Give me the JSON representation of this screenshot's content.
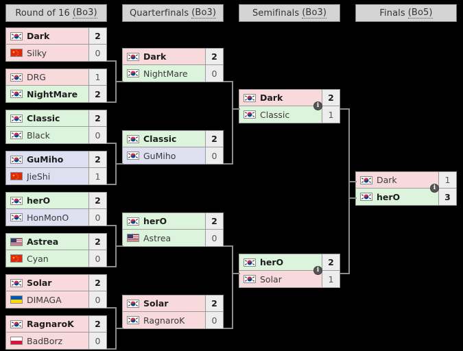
{
  "tournament": {
    "rounds": [
      {
        "id": "ro16",
        "label": "Round of 16",
        "format": "(Bo3)"
      },
      {
        "id": "qf",
        "label": "Quarterfinals",
        "format": "(Bo3)"
      },
      {
        "id": "sf",
        "label": "Semifinals",
        "format": "(Bo3)"
      },
      {
        "id": "f",
        "label": "Finals",
        "format": "(Bo5)"
      }
    ]
  },
  "colors": {
    "zerg": "#f8dadd",
    "protoss": "#dcf3dc",
    "terran": "#dfdff2",
    "score_cell": "#ededed",
    "header_bg": "#d4d4d4",
    "border": "#9a9a9a",
    "connector": "#8d8d8d",
    "background": "#000000",
    "info_badge": "#555555"
  },
  "info_badge": {
    "glyph": "i",
    "name": "match-info-icon"
  },
  "matches": {
    "ro16": [
      {
        "id": "ro16-m1",
        "top": {
          "name": "Dark",
          "score": "2",
          "flag": "kr",
          "race": "zerg",
          "winner": true
        },
        "bottom": {
          "name": "Silky",
          "score": "0",
          "flag": "cn",
          "race": "zerg",
          "winner": false
        }
      },
      {
        "id": "ro16-m2",
        "top": {
          "name": "DRG",
          "score": "1",
          "flag": "kr",
          "race": "zerg",
          "winner": false
        },
        "bottom": {
          "name": "NightMare",
          "score": "2",
          "flag": "kr",
          "race": "protoss",
          "winner": true
        }
      },
      {
        "id": "ro16-m3",
        "top": {
          "name": "Classic",
          "score": "2",
          "flag": "kr",
          "race": "protoss",
          "winner": true
        },
        "bottom": {
          "name": "Black",
          "score": "0",
          "flag": "kr",
          "race": "protoss",
          "winner": false
        }
      },
      {
        "id": "ro16-m4",
        "top": {
          "name": "GuMiho",
          "score": "2",
          "flag": "kr",
          "race": "terran",
          "winner": true
        },
        "bottom": {
          "name": "JieShi",
          "score": "1",
          "flag": "cn",
          "race": "terran",
          "winner": false
        }
      },
      {
        "id": "ro16-m5",
        "top": {
          "name": "herO",
          "score": "2",
          "flag": "kr",
          "race": "protoss",
          "winner": true
        },
        "bottom": {
          "name": "HonMonO",
          "score": "0",
          "flag": "kr",
          "race": "terran",
          "winner": false
        }
      },
      {
        "id": "ro16-m6",
        "top": {
          "name": "Astrea",
          "score": "2",
          "flag": "us",
          "race": "protoss",
          "winner": true
        },
        "bottom": {
          "name": "Cyan",
          "score": "0",
          "flag": "cn",
          "race": "protoss",
          "winner": false
        }
      },
      {
        "id": "ro16-m7",
        "top": {
          "name": "Solar",
          "score": "2",
          "flag": "kr",
          "race": "zerg",
          "winner": true
        },
        "bottom": {
          "name": "DIMAGA",
          "score": "0",
          "flag": "ua",
          "race": "zerg",
          "winner": false
        }
      },
      {
        "id": "ro16-m8",
        "top": {
          "name": "RagnaroK",
          "score": "2",
          "flag": "kr",
          "race": "zerg",
          "winner": true
        },
        "bottom": {
          "name": "BadBorz",
          "score": "0",
          "flag": "pl",
          "race": "zerg",
          "winner": false
        }
      }
    ],
    "qf": [
      {
        "id": "qf-m1",
        "top": {
          "name": "Dark",
          "score": "2",
          "flag": "kr",
          "race": "zerg",
          "winner": true
        },
        "bottom": {
          "name": "NightMare",
          "score": "0",
          "flag": "kr",
          "race": "protoss",
          "winner": false
        }
      },
      {
        "id": "qf-m2",
        "top": {
          "name": "Classic",
          "score": "2",
          "flag": "kr",
          "race": "protoss",
          "winner": true
        },
        "bottom": {
          "name": "GuMiho",
          "score": "0",
          "flag": "kr",
          "race": "terran",
          "winner": false
        }
      },
      {
        "id": "qf-m3",
        "top": {
          "name": "herO",
          "score": "2",
          "flag": "kr",
          "race": "protoss",
          "winner": true
        },
        "bottom": {
          "name": "Astrea",
          "score": "0",
          "flag": "us",
          "race": "protoss",
          "winner": false
        }
      },
      {
        "id": "qf-m4",
        "top": {
          "name": "Solar",
          "score": "2",
          "flag": "kr",
          "race": "zerg",
          "winner": true
        },
        "bottom": {
          "name": "RagnaroK",
          "score": "0",
          "flag": "kr",
          "race": "zerg",
          "winner": false
        }
      }
    ],
    "sf": [
      {
        "id": "sf-m1",
        "has_info": true,
        "top": {
          "name": "Dark",
          "score": "2",
          "flag": "kr",
          "race": "zerg",
          "winner": true
        },
        "bottom": {
          "name": "Classic",
          "score": "1",
          "flag": "kr",
          "race": "protoss",
          "winner": false
        }
      },
      {
        "id": "sf-m2",
        "has_info": true,
        "top": {
          "name": "herO",
          "score": "2",
          "flag": "kr",
          "race": "protoss",
          "winner": true
        },
        "bottom": {
          "name": "Solar",
          "score": "1",
          "flag": "kr",
          "race": "zerg",
          "winner": false
        }
      }
    ],
    "f": [
      {
        "id": "f-m1",
        "has_info": true,
        "top": {
          "name": "Dark",
          "score": "1",
          "flag": "kr",
          "race": "zerg",
          "winner": false
        },
        "bottom": {
          "name": "herO",
          "score": "3",
          "flag": "kr",
          "race": "protoss",
          "winner": true
        }
      }
    ]
  }
}
